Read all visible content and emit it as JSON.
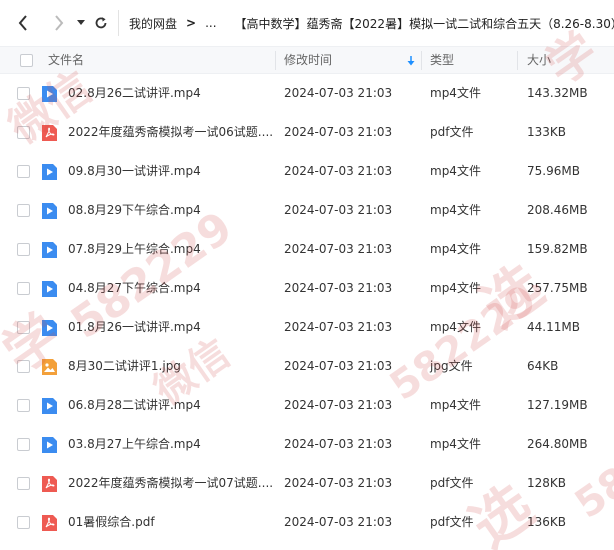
{
  "breadcrumb": {
    "root": "我的网盘",
    "arrow": ">",
    "ellipsis": "...",
    "current": "【高中数学】蕴秀斋【2022暑】模拟一试二试和综合五天（8.26-8.30）"
  },
  "columns": {
    "name": "文件名",
    "modified": "修改时间",
    "type": "类型",
    "size": "大小"
  },
  "files": [
    {
      "name": "02.8月26二试讲评.mp4",
      "date": "2024-07-03 21:03",
      "type": "mp4文件",
      "size": "143.32MB",
      "icon": "video-file-icon"
    },
    {
      "name": "2022年度蕴秀斋模拟考一试06试题....",
      "date": "2024-07-03 21:03",
      "type": "pdf文件",
      "size": "133KB",
      "icon": "pdf-file-icon"
    },
    {
      "name": "09.8月30一试讲评.mp4",
      "date": "2024-07-03 21:03",
      "type": "mp4文件",
      "size": "75.96MB",
      "icon": "video-file-icon"
    },
    {
      "name": "08.8月29下午综合.mp4",
      "date": "2024-07-03 21:03",
      "type": "mp4文件",
      "size": "208.46MB",
      "icon": "video-file-icon"
    },
    {
      "name": "07.8月29上午综合.mp4",
      "date": "2024-07-03 21:03",
      "type": "mp4文件",
      "size": "159.82MB",
      "icon": "video-file-icon"
    },
    {
      "name": "04.8月27下午综合.mp4",
      "date": "2024-07-03 21:03",
      "type": "mp4文件",
      "size": "257.75MB",
      "icon": "video-file-icon"
    },
    {
      "name": "01.8月26一试讲评.mp4",
      "date": "2024-07-03 21:03",
      "type": "mp4文件",
      "size": "44.11MB",
      "icon": "video-file-icon"
    },
    {
      "name": "8月30二试讲评1.jpg",
      "date": "2024-07-03 21:03",
      "type": "jpg文件",
      "size": "64KB",
      "icon": "image-file-icon"
    },
    {
      "name": "06.8月28二试讲评.mp4",
      "date": "2024-07-03 21:03",
      "type": "mp4文件",
      "size": "127.19MB",
      "icon": "video-file-icon"
    },
    {
      "name": "03.8月27上午综合.mp4",
      "date": "2024-07-03 21:03",
      "type": "mp4文件",
      "size": "264.80MB",
      "icon": "video-file-icon"
    },
    {
      "name": "2022年度蕴秀斋模拟考一试07试题....",
      "date": "2024-07-03 21:03",
      "type": "pdf文件",
      "size": "128KB",
      "icon": "pdf-file-icon"
    },
    {
      "name": "01暑假综合.pdf",
      "date": "2024-07-03 21:03",
      "type": "pdf文件",
      "size": "136KB",
      "icon": "pdf-file-icon"
    }
  ],
  "watermark": {
    "texts": [
      "微信",
      "582229",
      "学",
      "选",
      "58"
    ],
    "color": "#d14b4b"
  },
  "colors": {
    "video": "#3b8cf0",
    "pdf": "#ee5a52",
    "image": "#f3a03a",
    "sort_arrow": "#1e90ff"
  }
}
